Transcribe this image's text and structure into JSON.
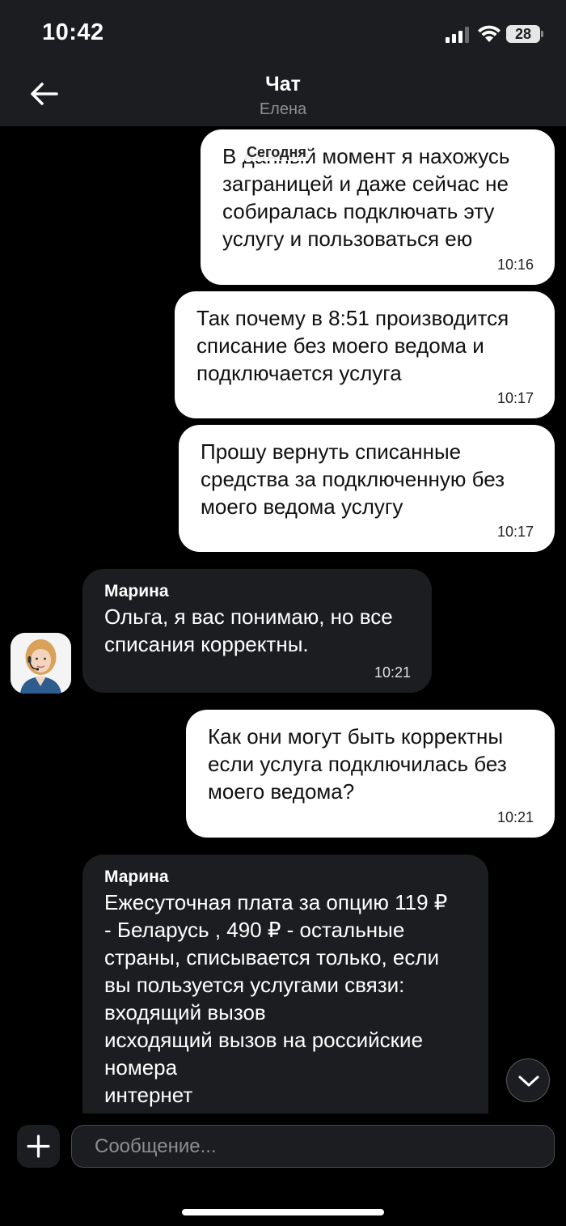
{
  "status_bar": {
    "time": "10:42",
    "battery": "28"
  },
  "header": {
    "title": "Чат",
    "subtitle": "Елена",
    "back_icon": "arrow-left-icon"
  },
  "chat": {
    "date_chip": "Сегодня",
    "messages": [
      {
        "direction": "out",
        "text": "В данный момент я нахожусь\nзаграницей и даже сейчас не\nсобиралась подключать эту\nуслугу и пользоваться ею",
        "time": "10:16"
      },
      {
        "direction": "out",
        "text": "Так почему в 8:51 производится\nсписание без моего ведома и\nподключается услуга",
        "time": "10:17"
      },
      {
        "direction": "out",
        "text": "Прошу вернуть списанные\nсредства за подключенную без\nмоего ведома услугу",
        "time": "10:17"
      },
      {
        "direction": "in",
        "sender": "Марина",
        "text": "Ольга, я вас понимаю, но все\nсписания корректны.",
        "time": "10:21"
      },
      {
        "direction": "out",
        "text": "Как они могут быть корректны\nесли услуга подключилась без\nмоего ведома?",
        "time": "10:21"
      },
      {
        "direction": "in",
        "sender": "Марина",
        "text": "Ежесуточная плата за опцию 119 ₽\n- Беларусь , 490 ₽ - остальные\nстраны, списывается только, если\nвы пользуется услугами связи:\nвходящий вызов\nисходящий вызов на российские\nномера\nинтернет\nММС",
        "time": ""
      }
    ]
  },
  "composer": {
    "placeholder": "Сообщение...",
    "add_icon": "plus-icon"
  },
  "scroll_button": {
    "icon": "chevron-down-icon"
  },
  "colors": {
    "background": "#000000",
    "bar": "#1c1d20",
    "outgoing": "#ffffff",
    "incoming": "#1c1d20",
    "muted": "#8e8e93"
  }
}
